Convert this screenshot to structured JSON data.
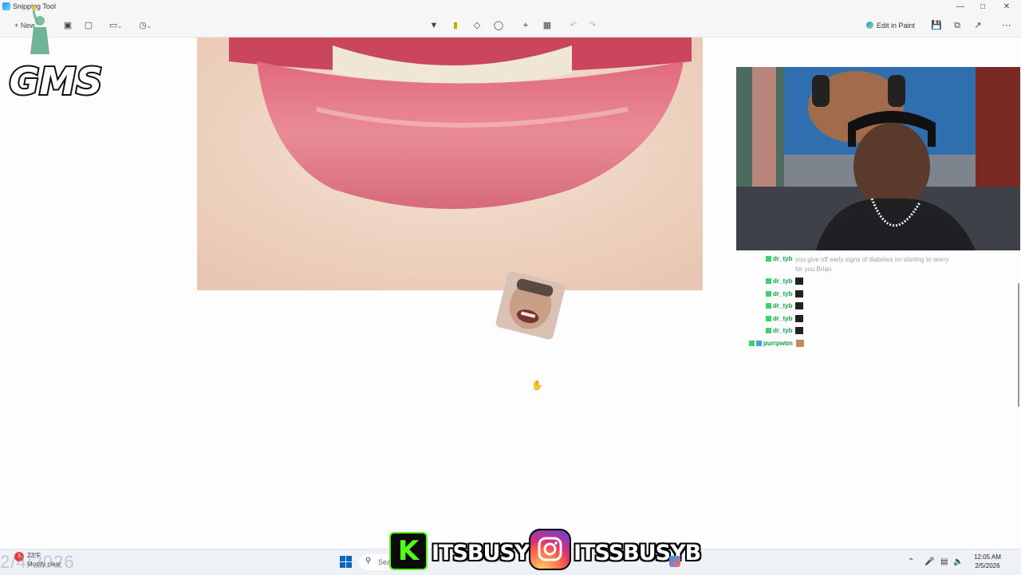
{
  "window": {
    "title": "Snipping Tool",
    "new_label": "New",
    "edit_in_paint_label": "Edit in Paint"
  },
  "overlay": {
    "logo_text": "GMS",
    "date_text": "2/4/2026",
    "kick_handle": "ITSBUSYB",
    "instagram_handle": "ITSSBUSYB"
  },
  "chat": {
    "messages": [
      {
        "user": "dr_tyb",
        "text": "you give off early signs of diabetes im starting to worry for you Brian"
      },
      {
        "user": "dr_tyb",
        "text": ""
      },
      {
        "user": "dr_tyb",
        "text": ""
      },
      {
        "user": "dr_tyb",
        "text": ""
      },
      {
        "user": "dr_tyb",
        "text": ""
      },
      {
        "user": "dr_tyb",
        "text": ""
      },
      {
        "user": "purrpwtm",
        "text": ""
      }
    ]
  },
  "taskbar": {
    "weather_temp": "23°F",
    "weather_desc": "Mostly clear",
    "weather_alert": "3",
    "search_placeholder": "Sea",
    "time": "12:05 AM",
    "date": "2/5/2026"
  },
  "colors": {
    "kick_green": "#53fc18",
    "chat_user_green": "#13a54a",
    "windows_blue": "#0067c0"
  }
}
